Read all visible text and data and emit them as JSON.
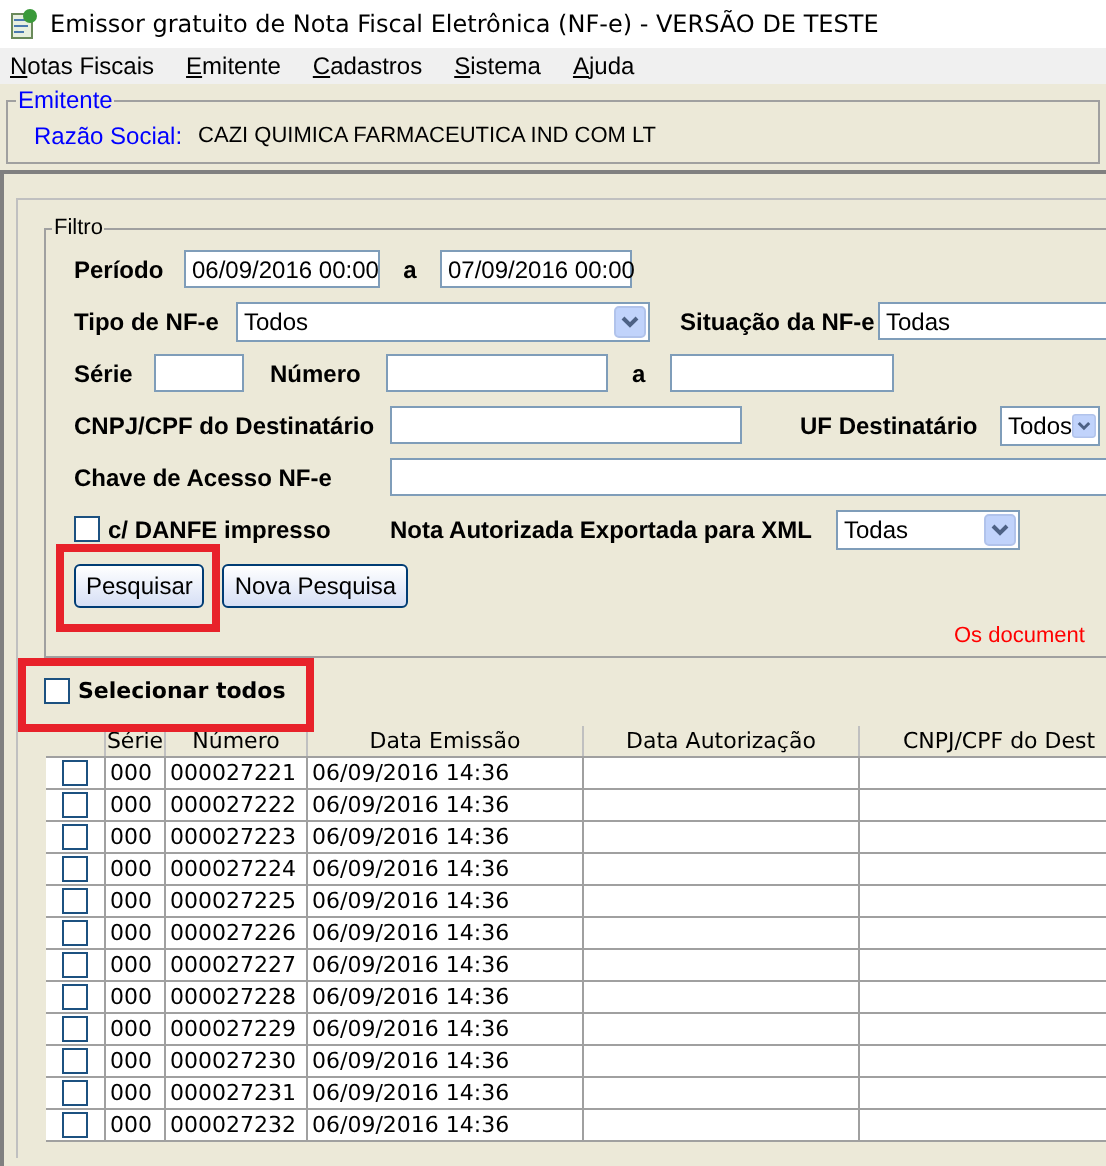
{
  "window": {
    "title": "Emissor gratuito de Nota Fiscal Eletrônica (NF-e) - VERSÃO DE TESTE"
  },
  "menu": [
    {
      "label": "Notas Fiscais"
    },
    {
      "label": "Emitente"
    },
    {
      "label": "Cadastros"
    },
    {
      "label": "Sistema"
    },
    {
      "label": "Ajuda"
    }
  ],
  "emitente": {
    "legend": "Emitente",
    "label": "Razão Social:",
    "value": "CAZI QUIMICA FARMACEUTICA IND COM LT"
  },
  "filtro": {
    "legend": "Filtro",
    "periodo": {
      "label": "Período",
      "from": "06/09/2016 00:00",
      "separator": "a",
      "to": "07/09/2016 00:00"
    },
    "tipo": {
      "label": "Tipo de NF-e",
      "value": "Todos"
    },
    "situacao": {
      "label": "Situação da NF-e",
      "value": "Todas"
    },
    "serie": {
      "label": "Série"
    },
    "numero": {
      "label": "Número",
      "separator": "a"
    },
    "cnpj": {
      "label": "CNPJ/CPF do Destinatário"
    },
    "uf": {
      "label": "UF Destinatário",
      "value": "Todos"
    },
    "chave": {
      "label": "Chave de Acesso NF-e"
    },
    "danfe": {
      "label": "c/ DANFE impresso",
      "checked": false
    },
    "exportada": {
      "label": "Nota Autorizada Exportada para XML",
      "value": "Todas"
    },
    "buttons": [
      {
        "label": "Pesquisar",
        "highlighted": true
      },
      {
        "label": "Nova Pesquisa"
      }
    ],
    "notice": "Os document"
  },
  "select_all": {
    "label": "Selecionar todos",
    "checked": false,
    "highlighted": true
  },
  "table": {
    "columns": [
      "Série",
      "Número",
      "Data Emissão",
      "Data Autorização",
      "CNPJ/CPF do Dest"
    ],
    "rows": [
      {
        "checked": false,
        "serie": "000",
        "numero": "000027221",
        "emissao": "06/09/2016 14:36"
      },
      {
        "checked": false,
        "serie": "000",
        "numero": "000027222",
        "emissao": "06/09/2016 14:36"
      },
      {
        "checked": false,
        "serie": "000",
        "numero": "000027223",
        "emissao": "06/09/2016 14:36"
      },
      {
        "checked": false,
        "serie": "000",
        "numero": "000027224",
        "emissao": "06/09/2016 14:36"
      },
      {
        "checked": false,
        "serie": "000",
        "numero": "000027225",
        "emissao": "06/09/2016 14:36"
      },
      {
        "checked": false,
        "serie": "000",
        "numero": "000027226",
        "emissao": "06/09/2016 14:36"
      },
      {
        "checked": false,
        "serie": "000",
        "numero": "000027227",
        "emissao": "06/09/2016 14:36"
      },
      {
        "checked": false,
        "serie": "000",
        "numero": "000027228",
        "emissao": "06/09/2016 14:36"
      },
      {
        "checked": false,
        "serie": "000",
        "numero": "000027229",
        "emissao": "06/09/2016 14:36"
      },
      {
        "checked": false,
        "serie": "000",
        "numero": "000027230",
        "emissao": "06/09/2016 14:36"
      },
      {
        "checked": false,
        "serie": "000",
        "numero": "000027231",
        "emissao": "06/09/2016 14:36"
      },
      {
        "checked": false,
        "serie": "000",
        "numero": "000027232",
        "emissao": "06/09/2016 14:36"
      }
    ]
  }
}
